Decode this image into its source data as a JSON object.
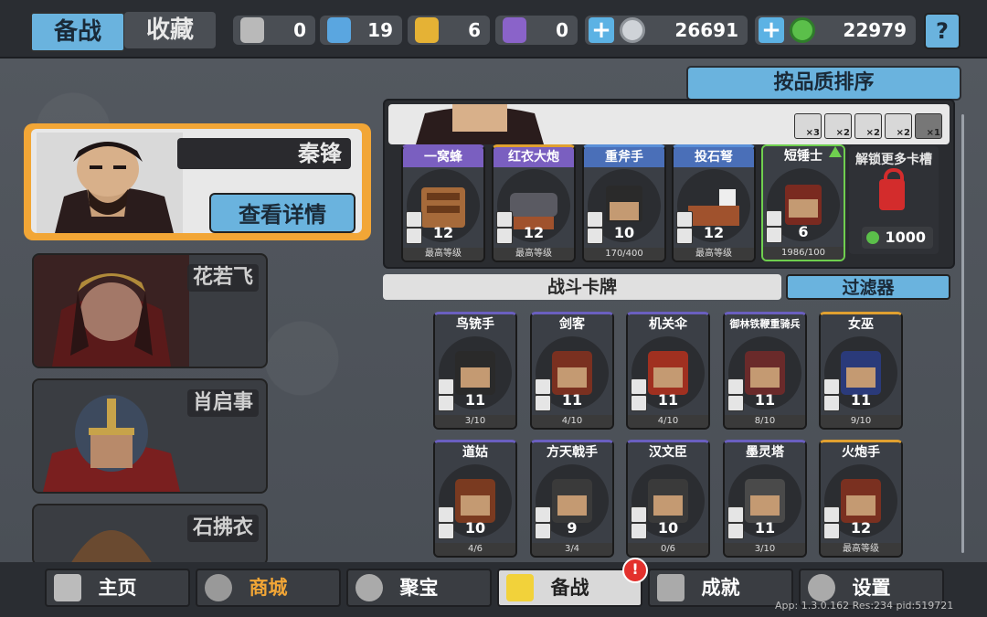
{
  "tabs": {
    "active": "备战",
    "inactive": "收藏"
  },
  "resources": [
    {
      "icon": "silver-shield-icon",
      "value": "0",
      "color": "#b9b9b9"
    },
    {
      "icon": "blue-shield-icon",
      "value": "19",
      "color": "#5aa6e0"
    },
    {
      "icon": "gold-shield-icon",
      "value": "6",
      "color": "#e5b235"
    },
    {
      "icon": "purple-shield-icon",
      "value": "0",
      "color": "#8a63c9"
    }
  ],
  "silver_coins": {
    "value": "26691"
  },
  "green_gems": {
    "value": "22979"
  },
  "help_label": "?",
  "sort_label": "按品质排序",
  "heroes": {
    "selected": {
      "name": "秦锋",
      "detail_label": "查看详情"
    },
    "list": [
      {
        "name": "花若飞"
      },
      {
        "name": "肖启事"
      },
      {
        "name": "石拂衣"
      }
    ]
  },
  "deck": {
    "pips": [
      "×3",
      "×2",
      "×2",
      "×2",
      "×1"
    ],
    "cards": [
      {
        "name": "一窝蜂",
        "level": "12",
        "progress": "最高等级",
        "border": "#7a5fc0"
      },
      {
        "name": "红衣大炮",
        "level": "12",
        "progress": "最高等级",
        "border": "#e0a030"
      },
      {
        "name": "重斧手",
        "level": "10",
        "progress": "170/400",
        "border": "#5a8fd8"
      },
      {
        "name": "投石弩",
        "level": "12",
        "progress": "最高等级",
        "border": "#5a8fd8"
      },
      {
        "name": "短锤士",
        "level": "6",
        "progress": "1986/100",
        "border": "#6fcf4f"
      }
    ],
    "unlock": {
      "label": "解锁更多卡槽",
      "cost": "1000"
    }
  },
  "battle_cards": {
    "header": "战斗卡牌",
    "filter_label": "过滤器",
    "cards": [
      {
        "name": "鸟铳手",
        "level": "11",
        "progress": "3/10",
        "border": "#6a5fc0"
      },
      {
        "name": "剑客",
        "level": "11",
        "progress": "4/10",
        "border": "#6a5fc0"
      },
      {
        "name": "机关伞",
        "level": "11",
        "progress": "4/10",
        "border": "#6a5fc0"
      },
      {
        "name": "御林铁鞭重骑兵",
        "level": "11",
        "progress": "8/10",
        "border": "#6a5fc0"
      },
      {
        "name": "女巫",
        "level": "11",
        "progress": "9/10",
        "border": "#e0a030"
      },
      {
        "name": "道姑",
        "level": "10",
        "progress": "4/6",
        "border": "#6a5fc0"
      },
      {
        "name": "方天戟手",
        "level": "9",
        "progress": "3/4",
        "border": "#6a5fc0"
      },
      {
        "name": "汉文臣",
        "level": "10",
        "progress": "0/6",
        "border": "#6a5fc0"
      },
      {
        "name": "墨灵塔",
        "level": "11",
        "progress": "3/10",
        "border": "#6a5fc0"
      },
      {
        "name": "火炮手",
        "level": "12",
        "progress": "最高等级",
        "border": "#e0a030"
      }
    ]
  },
  "nav": [
    {
      "label": "主页",
      "icon": "home-icon"
    },
    {
      "label": "商城",
      "icon": "shop-icon"
    },
    {
      "label": "聚宝",
      "icon": "treasure-icon"
    },
    {
      "label": "备战",
      "icon": "cards-icon"
    },
    {
      "label": "成就",
      "icon": "achievement-icon"
    },
    {
      "label": "设置",
      "icon": "gear-icon"
    }
  ],
  "nav_badge": "!",
  "app_info": "App: 1.3.0.162 Res:234 pid:519721"
}
